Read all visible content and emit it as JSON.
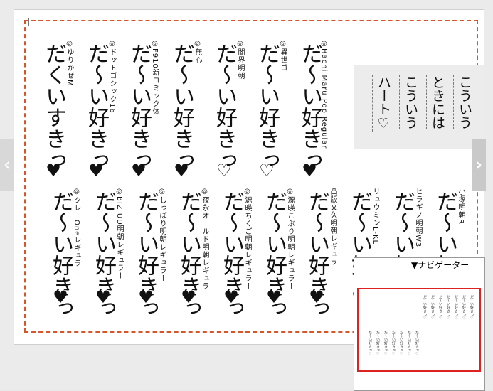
{
  "colors": {
    "dash_border": "#d8552a",
    "callout_bg": "#ececec",
    "navigator_frame": "#d22222"
  },
  "callout": {
    "lines": [
      "こういう",
      "ときには",
      "こういう",
      "ハート♡"
    ]
  },
  "top_row": [
    {
      "label": "◎Hachi Maru Pop Regular",
      "sample": "だ〜い好きっ",
      "heart": "♥"
    },
    {
      "label": "◎異世ゴ",
      "sample": "だ〜い好きっ",
      "heart": "♡"
    },
    {
      "label": "◎闇界明朝",
      "sample": "だ〜い好きっ",
      "heart": "♡"
    },
    {
      "label": "◎無心",
      "sample": "だ〜い好きっ",
      "heart": "♥"
    },
    {
      "label": "◎F910新コミック体",
      "sample": "だ〜い好きっ",
      "heart": "♥"
    },
    {
      "label": "◎ドットゴシック16",
      "sample": "だ〜い好きっ",
      "heart": "♥"
    },
    {
      "label": "◎ゆりかぜM",
      "sample": "だくいすきっ",
      "heart": "♥"
    }
  ],
  "bottom_row": [
    {
      "label": "小塚明朝R",
      "sample": "だ〜い好きっ",
      "heart": "♥"
    },
    {
      "label": "ヒラギノ明朝W3",
      "sample": "だ〜い好きっ",
      "heart": "♥"
    },
    {
      "label": "リュウミンL-KL",
      "sample": "だ〜い好きっ",
      "heart": "♥"
    },
    {
      "label": "凸版文久明朝レギュラー",
      "sample": "だ〜い好きっ",
      "heart": "♥"
    },
    {
      "label": "◎源暎こぶり明朝レギュラー",
      "sample": "だ〜い好きっ",
      "heart": "♥"
    },
    {
      "label": "◎源暎ちくご明朝レギュラー",
      "sample": "だ〜い好きっ",
      "heart": "♥"
    },
    {
      "label": "◎夜永オールド明朝レギュラー",
      "sample": "だ〜い好きっ",
      "heart": "♥"
    },
    {
      "label": "◎しっぽり明朝レギュラー",
      "sample": "だ〜い好きっ",
      "heart": "♥"
    },
    {
      "label": "◎BIZ UD明朝レギュラー",
      "sample": "だ〜い好きっ",
      "heart": "♥"
    },
    {
      "label": "◎クレーOneレギュラー",
      "sample": "だ〜い好きっ",
      "heart": "♥"
    }
  ],
  "navigator": {
    "title": "▼ナビゲーター"
  },
  "nav_arrows": {
    "left": "‹",
    "right": "›"
  }
}
